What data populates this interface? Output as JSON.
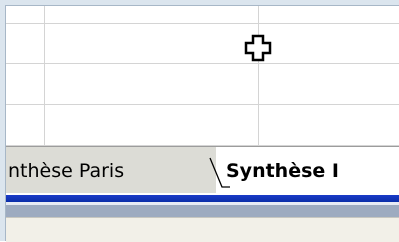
{
  "sheet_tabs": [
    {
      "label": "nthèse Paris",
      "active": false
    },
    {
      "label": "Synthèse I",
      "active": true
    }
  ],
  "cursor": {
    "icon": "plus-cursor-icon"
  },
  "colors": {
    "window_frame": "#dbe5ee",
    "gridline": "#d4d4d4",
    "tab_inactive": "#dcdcd6",
    "tab_active": "#ffffff",
    "taskbar_blue": "#0a2ea8",
    "status_grey": "#9dabc0"
  }
}
